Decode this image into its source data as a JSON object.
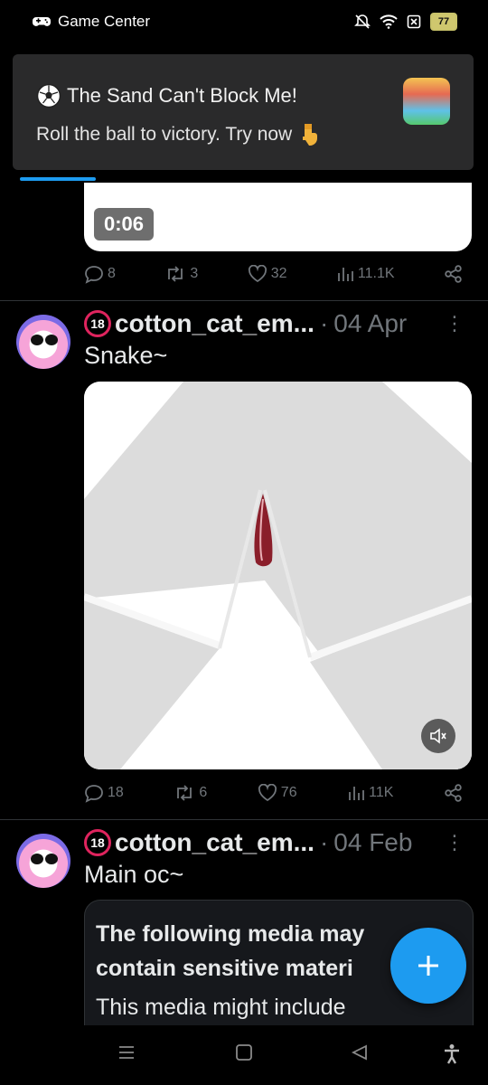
{
  "status_bar": {
    "app_name": "Game Center",
    "battery": "77"
  },
  "banner": {
    "title": "The Sand Can't Block Me!",
    "subtitle": "Roll the ball to victory. Try now"
  },
  "prev_post": {
    "duration": "0:06",
    "replies": "8",
    "reposts": "3",
    "likes": "32",
    "views": "11.1K"
  },
  "posts": [
    {
      "username": "cotton_cat_em...",
      "date": "04 Apr",
      "text": "Snake~",
      "replies": "18",
      "reposts": "6",
      "likes": "76",
      "views": "11K"
    },
    {
      "username": "cotton_cat_em...",
      "date": "04 Feb",
      "text": "Main oc~",
      "sensitive_title": "The following media may contain sensitive materi",
      "sensitive_body": "This media might include"
    }
  ],
  "badge_label": "18",
  "colors": {
    "accent": "#1d9bf0",
    "muted": "#71767b",
    "bg": "#000000"
  }
}
